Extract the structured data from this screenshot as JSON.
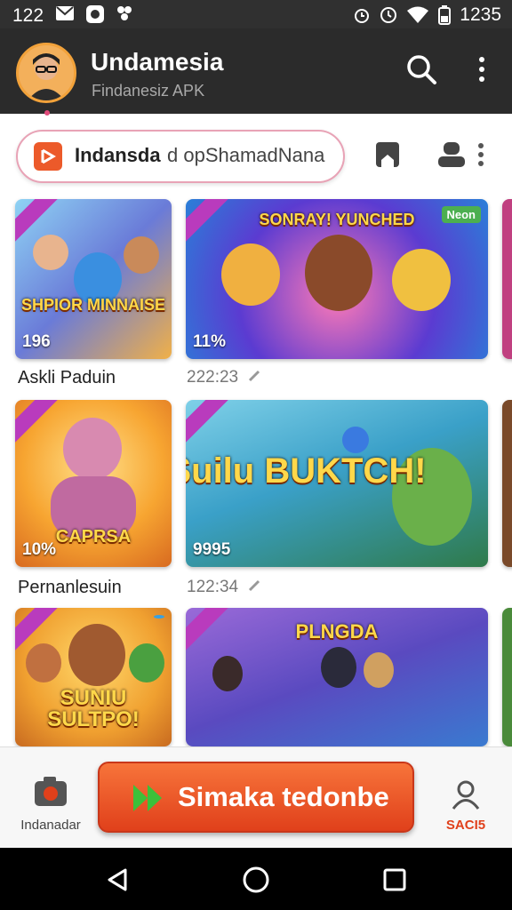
{
  "status_bar": {
    "time_left": "122",
    "time_right": "1235"
  },
  "app_bar": {
    "title": "Undamesia",
    "subtitle": "Findanesiz APK"
  },
  "search": {
    "app_name": "Indansda",
    "query": "d opShamadNana"
  },
  "games": [
    {
      "title_art": "SHPIOR MINNAISE",
      "count": "196",
      "label": "Askli Paduin",
      "badge": ""
    },
    {
      "title_art": "SONRAY! YUNCHED",
      "count": "11%",
      "label": "",
      "meta": "222:23",
      "badge": "Neon"
    },
    {
      "title_art": "CAPRSA",
      "count": "10%",
      "label": "Pernanlesuin",
      "badge": ""
    },
    {
      "title_art": "Suilu BUKTCH!",
      "count": "9995",
      "label": "",
      "meta": "122:34",
      "badge": ""
    },
    {
      "title_art": "SUNIU SULTPO!",
      "count": "",
      "label": "",
      "badge": ""
    },
    {
      "title_art": "PLNGDA",
      "count": "",
      "label": "",
      "badge": ""
    }
  ],
  "bottom_nav": {
    "left_label": "Indanadar",
    "cta_label": "Simaka tedonbe",
    "right_label": "SACI5"
  },
  "colors": {
    "accent": "#e0401b",
    "appbar": "#2b2b2b",
    "status": "#303030"
  }
}
